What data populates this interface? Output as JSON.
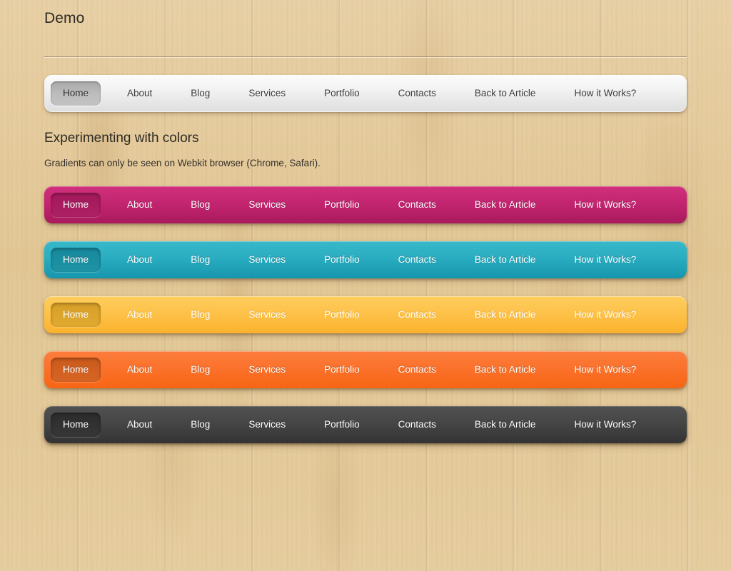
{
  "header": {
    "site_title": "Demo"
  },
  "section": {
    "title": "Experimenting with colors",
    "subtitle": "Gradients can only be seen on Webkit browser (Chrome, Safari)."
  },
  "nav_items": [
    "Home",
    "About",
    "Blog",
    "Services",
    "Portfolio",
    "Contacts",
    "Back to Article",
    "How it Works?"
  ],
  "navbars": [
    {
      "id": "navbar-default",
      "variant": "light",
      "active_index": 0,
      "colors": {
        "top": "#fbfbfb",
        "bottom": "#dedede",
        "active": "#bdbdbd",
        "text": "#3b3b3b"
      }
    },
    {
      "id": "navbar-pink",
      "variant": "pink",
      "active_index": 0,
      "colors": {
        "top": "#d0307d",
        "bottom": "#a91a5d",
        "active": "#a3195a",
        "text": "#ffffff"
      }
    },
    {
      "id": "navbar-teal",
      "variant": "teal",
      "active_index": 0,
      "colors": {
        "top": "#38b9ca",
        "bottom": "#1696ad",
        "active": "#17889c",
        "text": "#ffffff"
      }
    },
    {
      "id": "navbar-yellow",
      "variant": "yellow",
      "active_index": 0,
      "colors": {
        "top": "#fecd5d",
        "bottom": "#fbb22c",
        "active": "#d79f28",
        "text": "#ffffff"
      }
    },
    {
      "id": "navbar-orange",
      "variant": "orange",
      "active_index": 0,
      "colors": {
        "top": "#fd7d3d",
        "bottom": "#f66513",
        "active": "#ca5a1b",
        "text": "#ffffff"
      }
    },
    {
      "id": "navbar-dark",
      "variant": "dark",
      "active_index": 0,
      "colors": {
        "top": "#515151",
        "bottom": "#333333",
        "active": "#2c2c2c",
        "text": "#ffffff"
      }
    }
  ],
  "background": {
    "texture": "wood-maple",
    "base_color": "#e5cb9d"
  }
}
